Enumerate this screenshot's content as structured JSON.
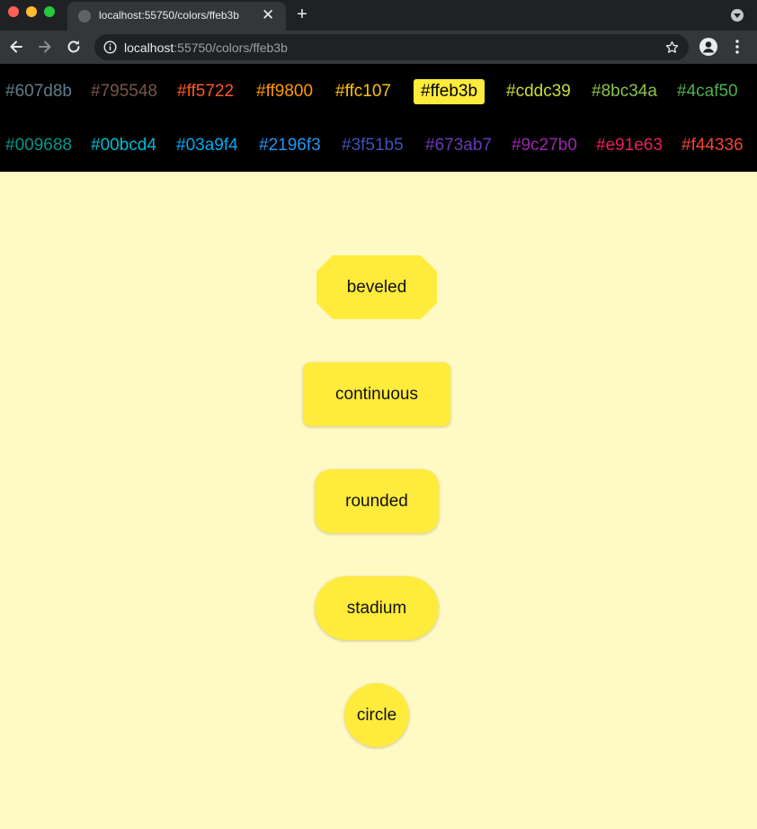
{
  "browser": {
    "tab_title": "localhost:55750/colors/ffeb3b",
    "tab_close": "✕",
    "new_tab": "+",
    "url_host": "localhost",
    "url_rest": ":55750/colors/ffeb3b"
  },
  "colors": [
    {
      "label": "#607d8b",
      "color": "#607d8b",
      "selected": false
    },
    {
      "label": "#795548",
      "color": "#795548",
      "selected": false
    },
    {
      "label": "#ff5722",
      "color": "#ff5722",
      "selected": false
    },
    {
      "label": "#ff9800",
      "color": "#ff9800",
      "selected": false
    },
    {
      "label": "#ffc107",
      "color": "#ffc107",
      "selected": false
    },
    {
      "label": "#ffeb3b",
      "color": "#ffeb3b",
      "selected": true
    },
    {
      "label": "#cddc39",
      "color": "#cddc39",
      "selected": false
    },
    {
      "label": "#8bc34a",
      "color": "#8bc34a",
      "selected": false
    },
    {
      "label": "#4caf50",
      "color": "#4caf50",
      "selected": false
    },
    {
      "label": "#009688",
      "color": "#009688",
      "selected": false
    },
    {
      "label": "#00bcd4",
      "color": "#00bcd4",
      "selected": false
    },
    {
      "label": "#03a9f4",
      "color": "#03a9f4",
      "selected": false
    },
    {
      "label": "#2196f3",
      "color": "#2196f3",
      "selected": false
    },
    {
      "label": "#3f51b5",
      "color": "#3f51b5",
      "selected": false
    },
    {
      "label": "#673ab7",
      "color": "#673ab7",
      "selected": false
    },
    {
      "label": "#9c27b0",
      "color": "#9c27b0",
      "selected": false
    },
    {
      "label": "#e91e63",
      "color": "#e91e63",
      "selected": false
    },
    {
      "label": "#f44336",
      "color": "#f44336",
      "selected": false
    }
  ],
  "buttons": {
    "beveled": "beveled",
    "continuous": "continuous",
    "rounded": "rounded",
    "stadium": "stadium",
    "circle": "circle"
  },
  "theme": {
    "accent": "#ffeb3b",
    "page_background": "#fff9c4",
    "nav_background": "#000000"
  }
}
